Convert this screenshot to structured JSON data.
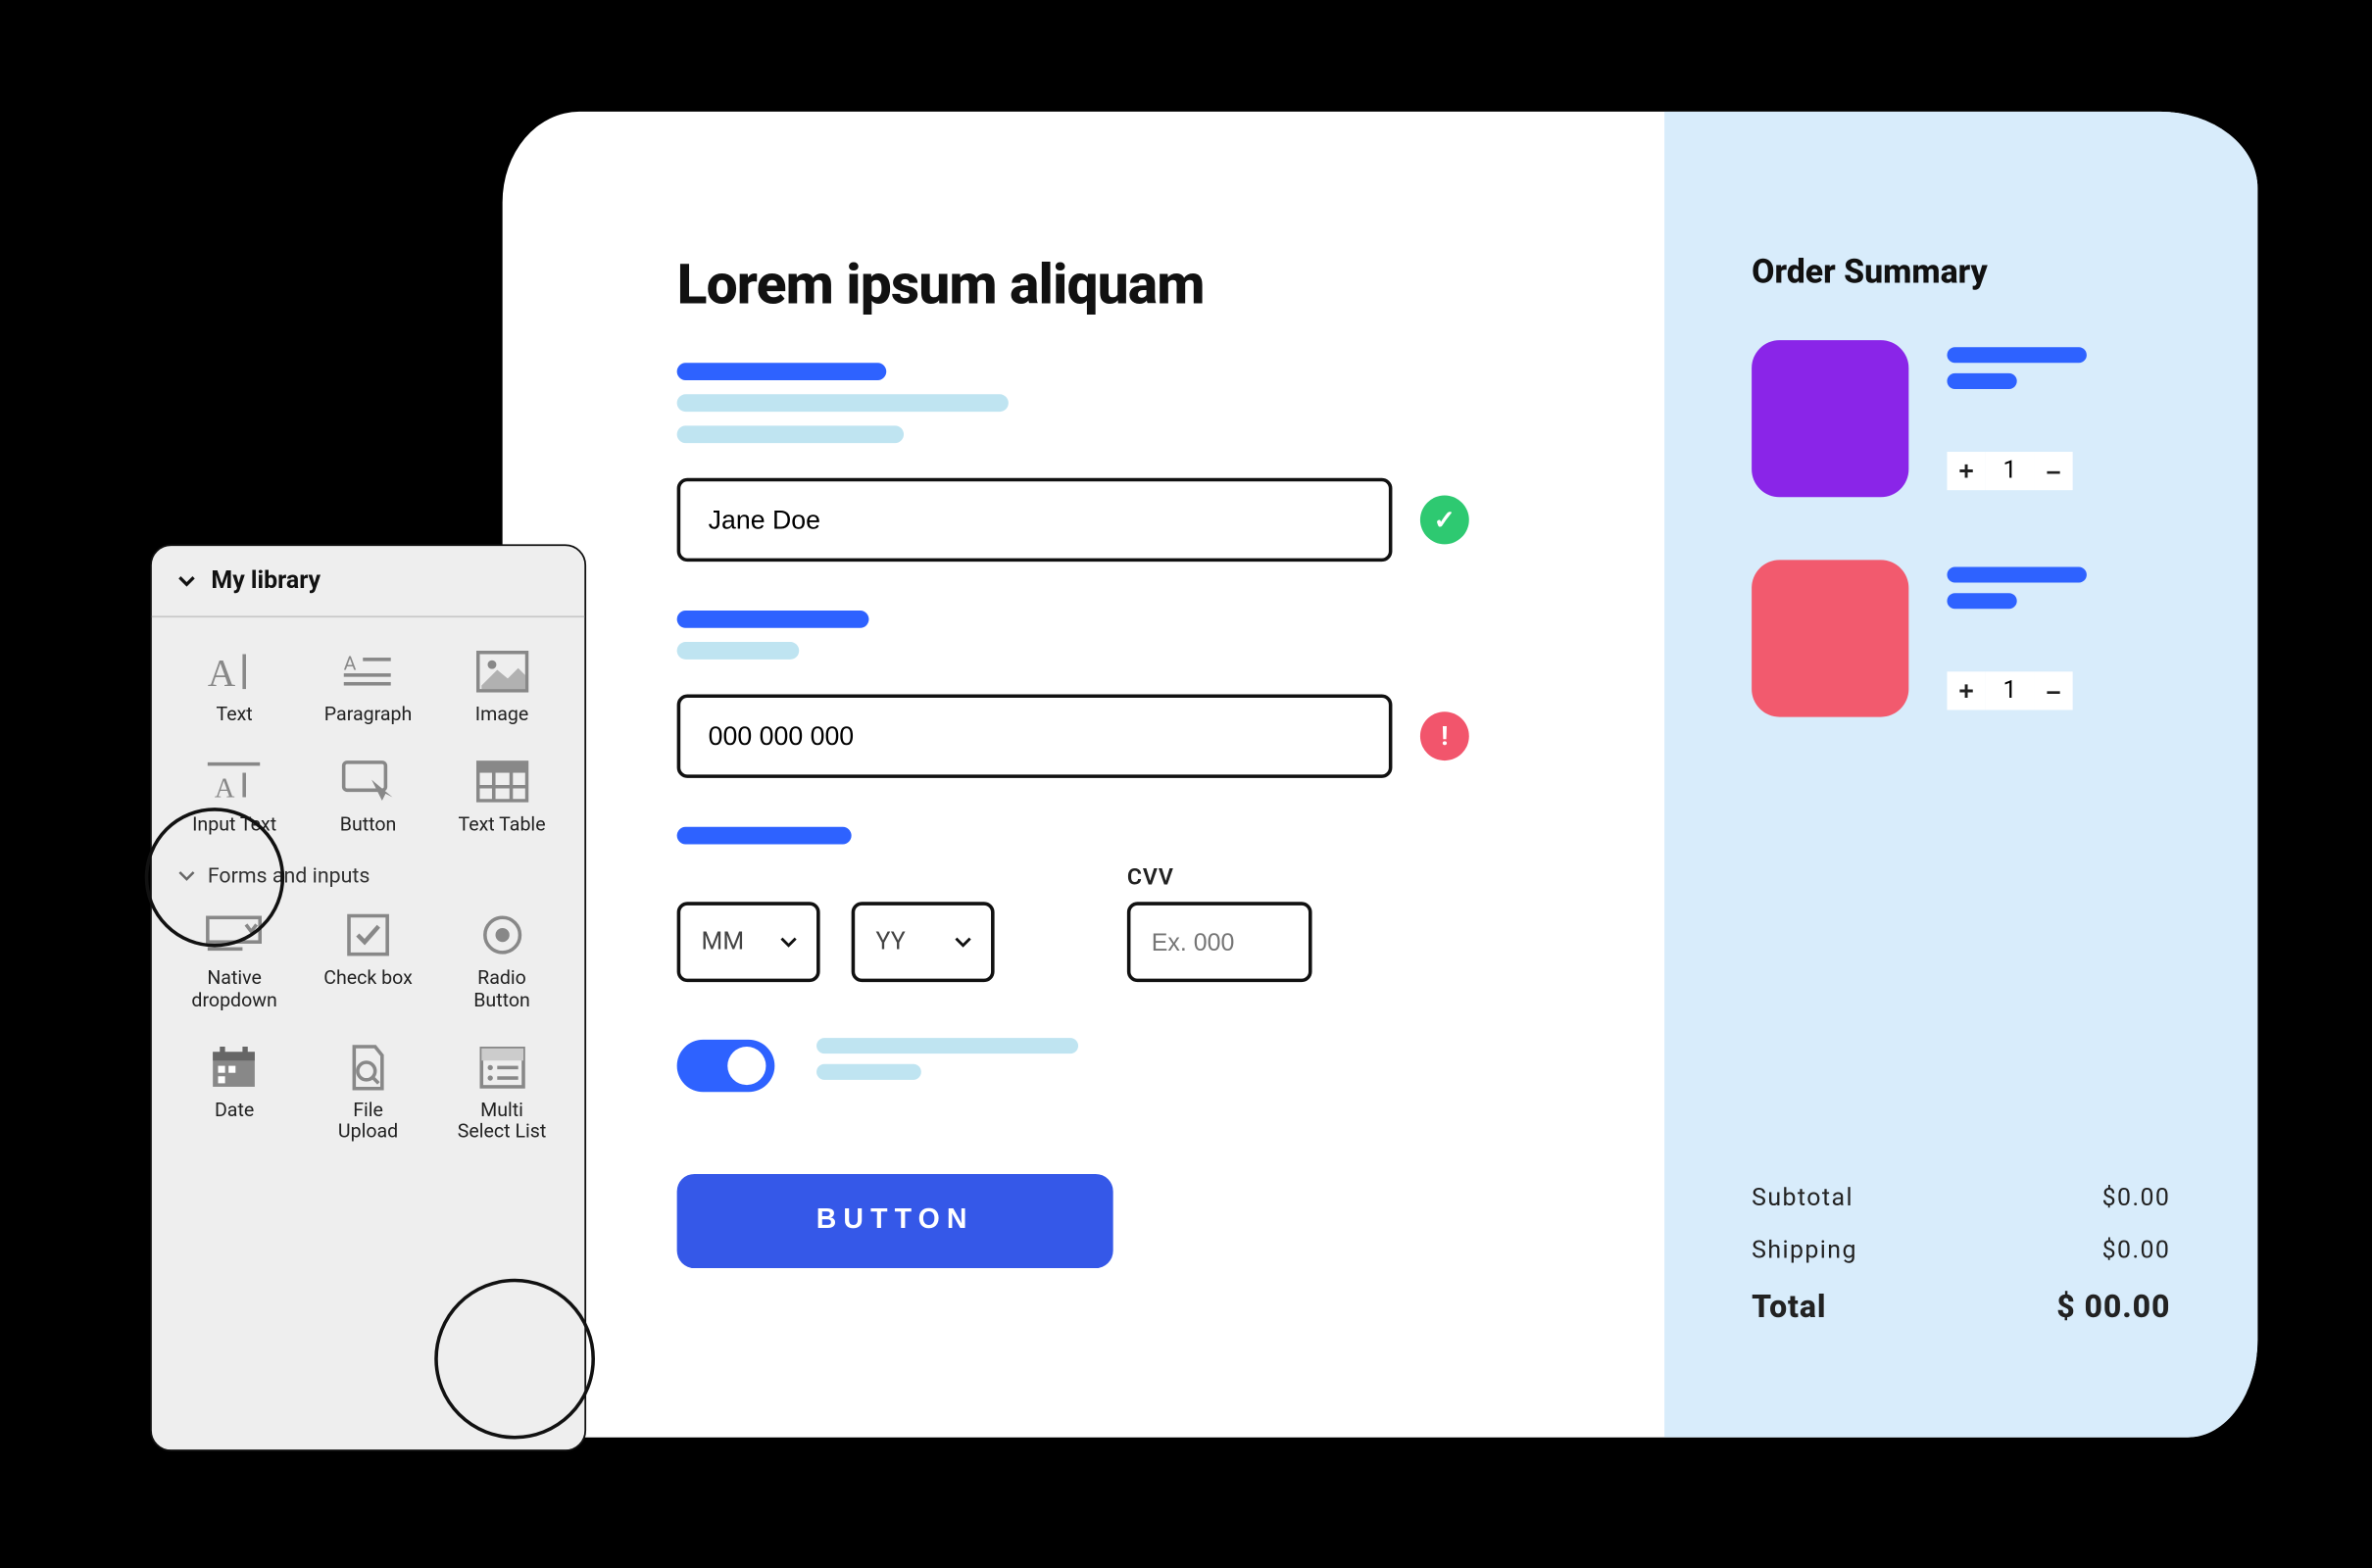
{
  "page": {
    "title": "Lorem ipsum aliquam",
    "name_field": {
      "value": "Jane Doe"
    },
    "number_field": {
      "value": "000 000 000"
    },
    "expiry": {
      "month": "MM",
      "year": "YY"
    },
    "cvv": {
      "label": "CVV",
      "placeholder": "Ex. 000"
    },
    "submit_label": "BUTTON"
  },
  "order": {
    "title": "Order Summary",
    "items": [
      {
        "color_swatch": "#8a25e8",
        "qty": 1
      },
      {
        "color_swatch": "#f25a6e",
        "qty": 1
      }
    ],
    "subtotal_label": "Subtotal",
    "subtotal_value": "$0.00",
    "shipping_label": "Shipping",
    "shipping_value": "$0.00",
    "total_label": "Total",
    "total_value": "$ 00.00"
  },
  "library": {
    "title": "My library",
    "sections": {
      "top": [
        {
          "id": "text",
          "label": "Text"
        },
        {
          "id": "paragraph",
          "label": "Paragraph"
        },
        {
          "id": "image",
          "label": "Image"
        },
        {
          "id": "input-text",
          "label": "Input Text"
        },
        {
          "id": "button",
          "label": "Button"
        },
        {
          "id": "text-table",
          "label": "Text Table"
        }
      ],
      "forms_heading": "Forms and inputs",
      "forms": [
        {
          "id": "native-dropdown",
          "label": "Native\ndropdown"
        },
        {
          "id": "check-box",
          "label": "Check box"
        },
        {
          "id": "radio-button",
          "label": "Radio\nButton"
        },
        {
          "id": "date",
          "label": "Date"
        },
        {
          "id": "file-upload",
          "label": "File\nUpload"
        },
        {
          "id": "multi-select",
          "label": "Multi\nSelect List"
        }
      ]
    }
  },
  "glyphs": {
    "plus": "+",
    "minus": "–",
    "check": "✓",
    "bang": "!"
  }
}
